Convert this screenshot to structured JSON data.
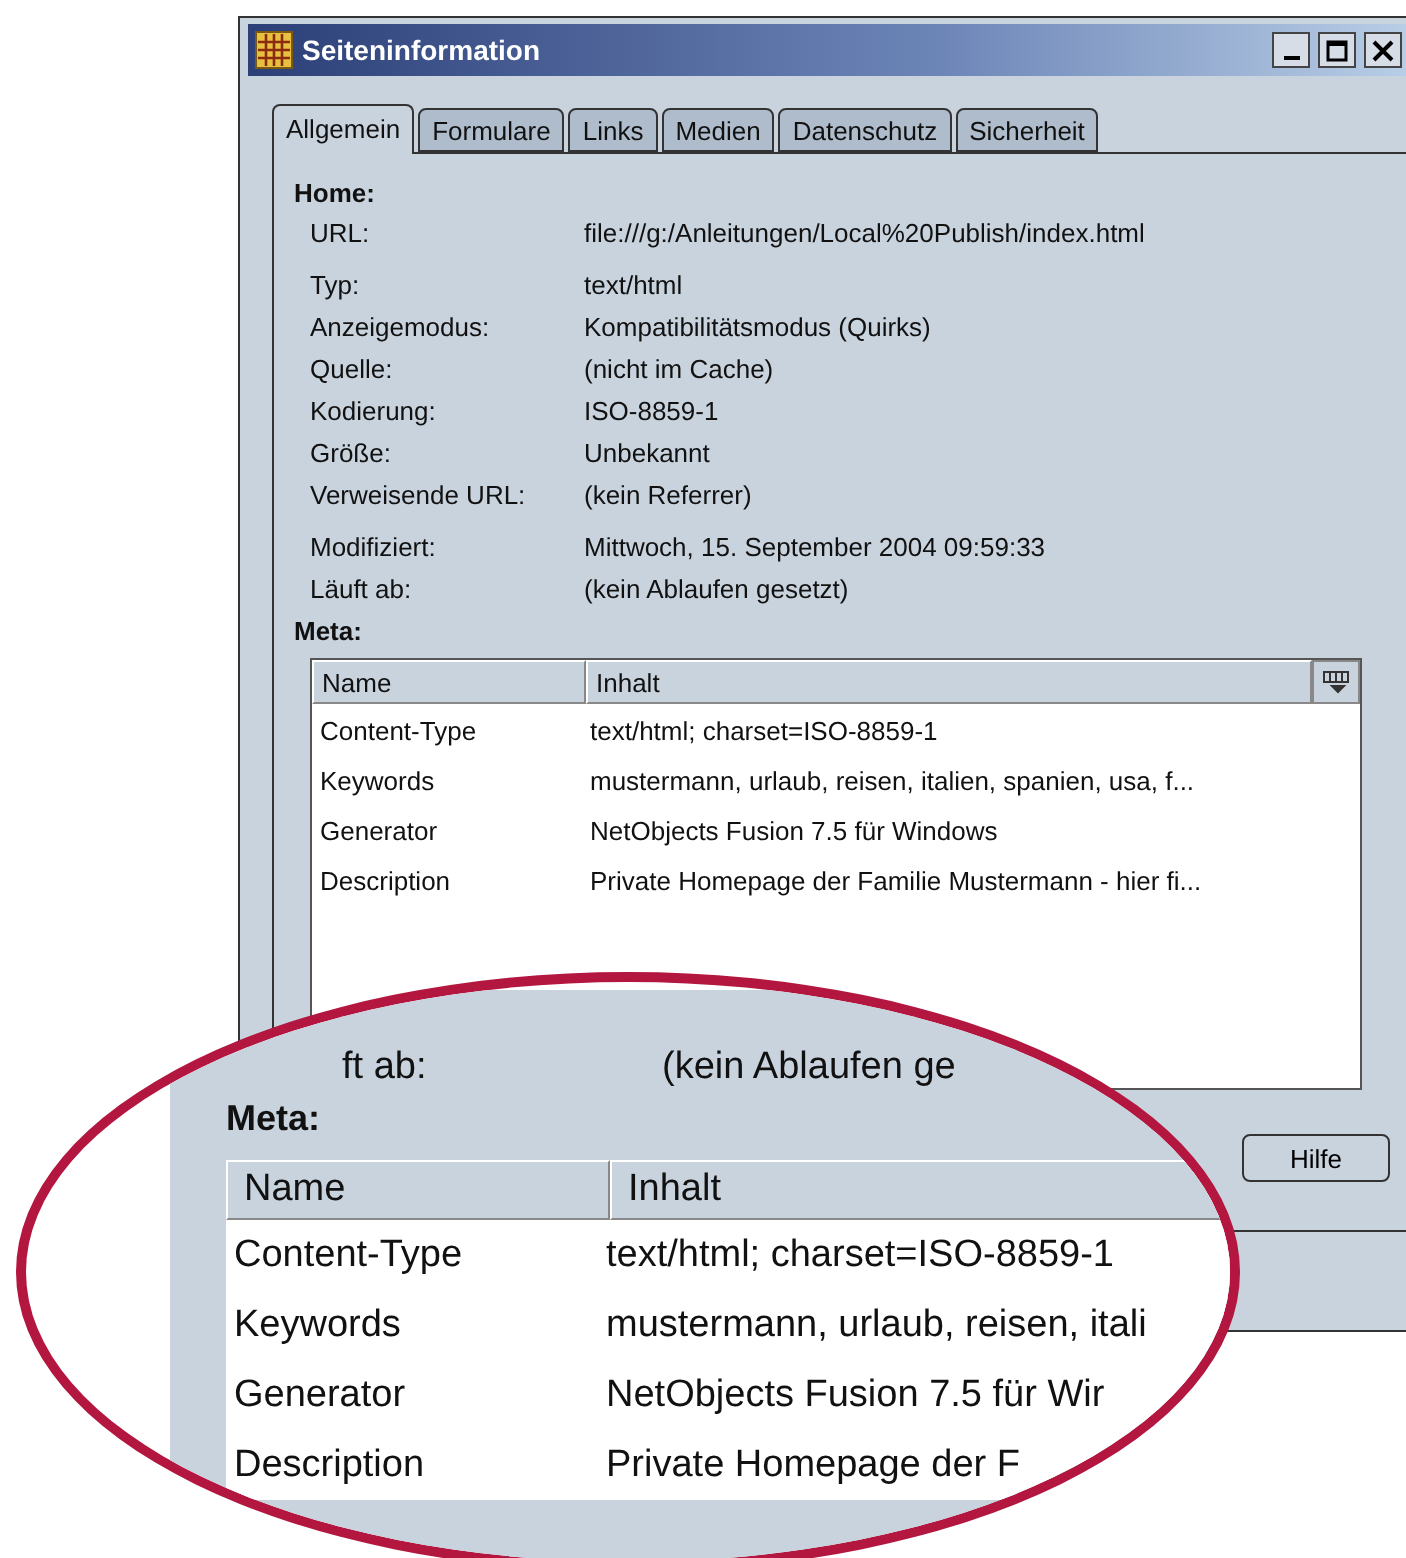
{
  "window": {
    "title": "Seiteninformation"
  },
  "tabs": [
    {
      "label": "Allgemein",
      "selected": true
    },
    {
      "label": "Formulare",
      "selected": false
    },
    {
      "label": "Links",
      "selected": false
    },
    {
      "label": "Medien",
      "selected": false
    },
    {
      "label": "Datenschutz",
      "selected": false
    },
    {
      "label": "Sicherheit",
      "selected": false
    }
  ],
  "general": {
    "heading": "Home:",
    "field_groups": [
      [
        {
          "label": "URL:",
          "value": "file:///g:/Anleitungen/Local%20Publish/index.html"
        }
      ],
      [
        {
          "label": "Typ:",
          "value": "text/html"
        },
        {
          "label": "Anzeigemodus:",
          "value": "Kompatibilitätsmodus (Quirks)"
        },
        {
          "label": "Quelle:",
          "value": "(nicht im Cache)"
        },
        {
          "label": "Kodierung:",
          "value": "ISO-8859-1"
        },
        {
          "label": "Größe:",
          "value": "Unbekannt"
        },
        {
          "label": "Verweisende URL:",
          "value": "(kein Referrer)"
        }
      ],
      [
        {
          "label": "Modifiziert:",
          "value": "Mittwoch, 15. September 2004 09:59:33"
        },
        {
          "label": "Läuft ab:",
          "value": "(kein Ablaufen gesetzt)"
        }
      ]
    ]
  },
  "meta": {
    "heading": "Meta:",
    "columns": [
      "Name",
      "Inhalt"
    ],
    "rows": [
      [
        "Content-Type",
        "text/html; charset=ISO-8859-1"
      ],
      [
        "Keywords",
        "mustermann, urlaub, reisen, italien, spanien, usa, f..."
      ],
      [
        "Generator",
        "NetObjects Fusion 7.5 für Windows"
      ],
      [
        "Description",
        "Private Homepage der Familie Mustermann - hier fi..."
      ]
    ]
  },
  "buttons": [
    "Hilfe"
  ],
  "magnifier": {
    "expires_label": "ft ab:",
    "expires_value": "(kein Ablaufen ge",
    "heading": "Meta:",
    "columns": [
      "Name",
      "Inhalt"
    ],
    "rows": [
      [
        "Content-Type",
        "text/html; charset=ISO-8859-1"
      ],
      [
        "Keywords",
        "mustermann, urlaub, reisen, itali"
      ],
      [
        "Generator",
        "NetObjects Fusion 7.5 für Wir"
      ],
      [
        "Description",
        "Private Homepage der F"
      ]
    ]
  }
}
